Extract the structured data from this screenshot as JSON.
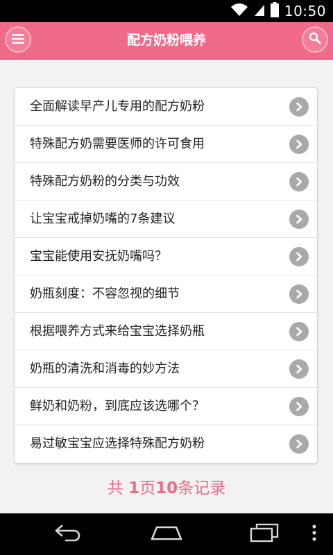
{
  "status_bar": {
    "time": "10:50",
    "icons": [
      "wifi-icon",
      "signal-icon",
      "battery-icon"
    ]
  },
  "header": {
    "title": "配方奶粉喂养",
    "menu_icon": "hamburger-menu-icon",
    "search_icon": "search-icon",
    "colors": {
      "bar": "#f06a8a",
      "button": "#f47e99"
    }
  },
  "articles": [
    {
      "title": "全面解读早产儿专用的配方奶粉"
    },
    {
      "title": "特殊配方奶需要医师的许可食用"
    },
    {
      "title": "特殊配方奶粉的分类与功效"
    },
    {
      "title": "让宝宝戒掉奶嘴的7条建议"
    },
    {
      "title": "宝宝能使用安抚奶嘴吗？"
    },
    {
      "title": "奶瓶刻度：不容忽视的细节"
    },
    {
      "title": "根据喂养方式来给宝宝选择奶瓶"
    },
    {
      "title": "奶瓶的清洗和消毒的妙方法"
    },
    {
      "title": "鲜奶和奶粉，到底应该选哪个？"
    },
    {
      "title": "易过敏宝宝应选择特殊配方奶粉"
    }
  ],
  "pagination": {
    "prefix": "共 ",
    "pages": "1",
    "pages_unit": "页",
    "records": "10",
    "records_unit": "条记录",
    "accent": "#ee6d8b"
  },
  "nav_bar": {
    "icons": [
      "back-icon",
      "home-icon",
      "recent-apps-icon",
      "overflow-menu-icon"
    ]
  }
}
